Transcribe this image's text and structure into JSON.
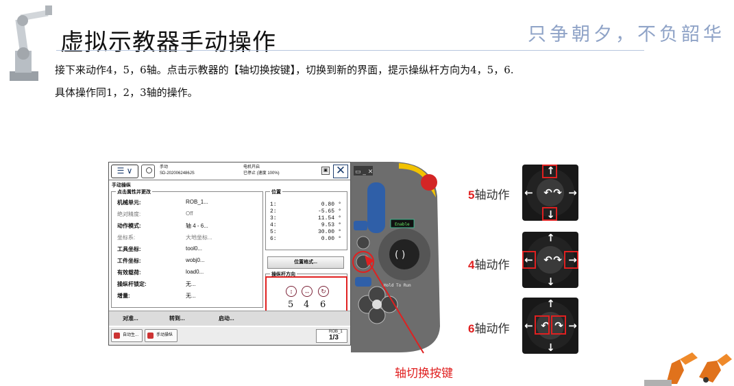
{
  "slide": {
    "title": "虚拟示教器手动操作",
    "slogan": "只争朝夕，不负韶华",
    "line1": "接下来动作4，5，6轴。点击示教器的【轴切换按键】，切换到新的界面，提示操纵杆方向为4，5，6.",
    "line2": "具体操作同1，2，3轴的操作。",
    "caption": "轴切换按键"
  },
  "status": {
    "mode": "手动",
    "system": "SD-2020062486JS",
    "motor": "电机开启",
    "state": "已停止 (速度 100%)"
  },
  "screen": {
    "crumb": "手动操纵",
    "props_title": "点击属性并更改",
    "props": [
      {
        "key": "机械单元:",
        "value": "ROB_1...",
        "dim": false
      },
      {
        "key": "绝对精度:",
        "value": "Off",
        "dim": true
      },
      {
        "key": "动作模式:",
        "value": "轴 4 - 6...",
        "dim": false
      },
      {
        "key": "坐标系:",
        "value": "大地坐标...",
        "dim": true
      },
      {
        "key": "工具坐标:",
        "value": "tool0...",
        "dim": false
      },
      {
        "key": "工件坐标:",
        "value": "wobj0...",
        "dim": false
      },
      {
        "key": "有效载荷:",
        "value": "load0...",
        "dim": false
      },
      {
        "key": "操纵杆锁定:",
        "value": "无...",
        "dim": false
      },
      {
        "key": "增量:",
        "value": "无...",
        "dim": false
      }
    ],
    "position_title": "位置",
    "positions": [
      {
        "axis": "1:",
        "value": "0.80",
        "unit": "°"
      },
      {
        "axis": "2:",
        "value": "-5.65",
        "unit": "°"
      },
      {
        "axis": "3:",
        "value": "11.54",
        "unit": "°"
      },
      {
        "axis": "4:",
        "value": "9.53",
        "unit": "°"
      },
      {
        "axis": "5:",
        "value": "30.00",
        "unit": "°"
      },
      {
        "axis": "6:",
        "value": "0.00",
        "unit": "°"
      }
    ],
    "format_button": "位置格式...",
    "joystick_title": "操纵杆方向",
    "joystick_axes": [
      "5",
      "4",
      "6"
    ],
    "bottom_buttons": [
      "对准...",
      "转到...",
      "启动..."
    ],
    "tasks": [
      "自动生...",
      "手动操纵"
    ],
    "rob_label": "ROB_1",
    "rob_fraction": "1/3"
  },
  "flexpendant": {
    "enable_label": "Enable",
    "hold_label": "Hold To Run"
  },
  "actions": [
    {
      "num": "5",
      "label": "轴动作"
    },
    {
      "num": "4",
      "label": "轴动作"
    },
    {
      "num": "6",
      "label": "轴动作"
    }
  ],
  "colors": {
    "accent": "#e02020",
    "slogan": "#8fa3c7",
    "pendant_body": "#6d6d6d",
    "pendant_yellow": "#f2c200",
    "emergency": "#d32525"
  }
}
